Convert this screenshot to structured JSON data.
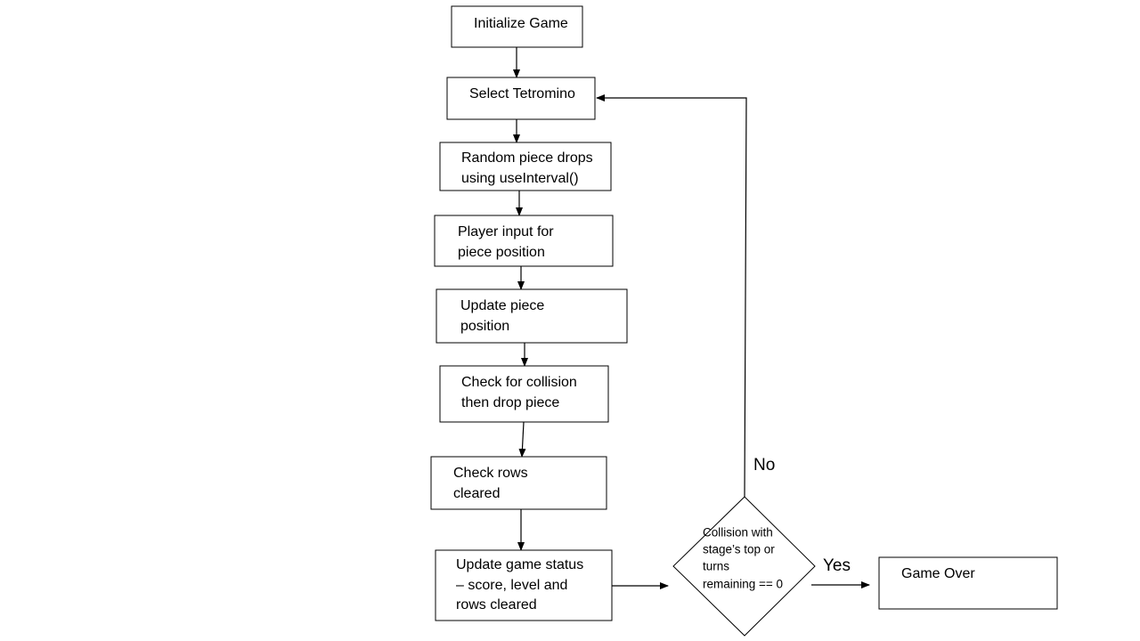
{
  "nodes": {
    "init": {
      "lines": [
        "Initialize Game"
      ]
    },
    "select": {
      "lines": [
        "Select Tetromino"
      ]
    },
    "drop": {
      "lines": [
        "Random piece drops",
        "using useInterval()"
      ]
    },
    "input": {
      "lines": [
        "Player input for",
        "piece position"
      ]
    },
    "update_pos": {
      "lines": [
        "Update piece",
        "position"
      ]
    },
    "collision": {
      "lines": [
        "Check for collision",
        "then drop piece"
      ]
    },
    "rows": {
      "lines": [
        "Check rows",
        "cleared"
      ]
    },
    "status": {
      "lines": [
        "Update game status",
        "– score, level and",
        "rows cleared"
      ]
    },
    "decision": {
      "lines": [
        "Collision with",
        "stage’s top or",
        "turns",
        "remaining == 0"
      ]
    },
    "gameover": {
      "lines": [
        "Game Over"
      ]
    }
  },
  "edges": {
    "yes_label": "Yes",
    "no_label": "No"
  }
}
